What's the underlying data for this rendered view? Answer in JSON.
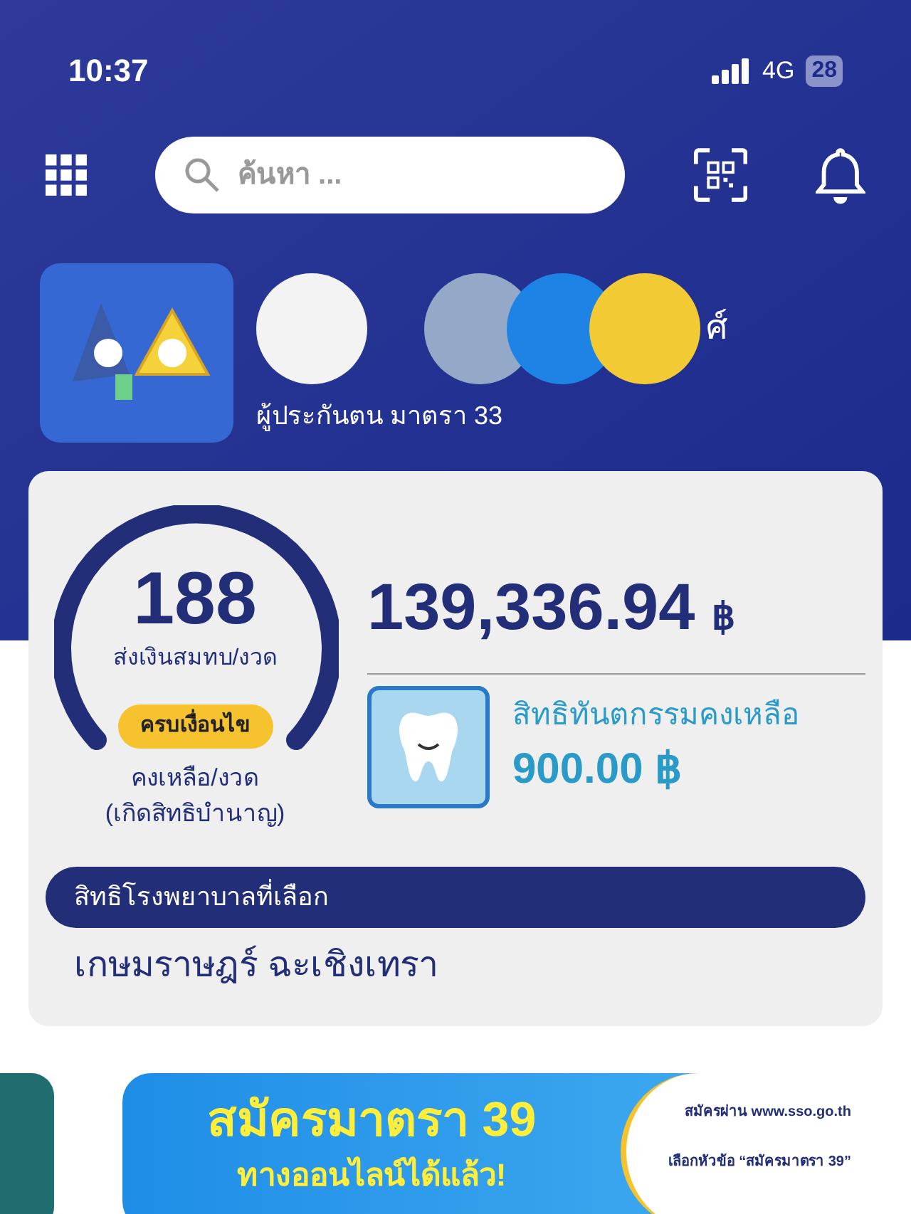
{
  "status_bar": {
    "time": "10:37",
    "network": "4G",
    "battery": "28"
  },
  "search": {
    "placeholder": "ค้นหา ..."
  },
  "profile": {
    "name_fragment": "ศ์",
    "member_type": "ผู้ประกันตน มาตรา 33"
  },
  "summary": {
    "count": "188",
    "count_label": "ส่งเงินสมทบ/งวด",
    "badge": "ครบเงื่อนไข",
    "remaining_label": "คงเหลือ/งวด",
    "remaining_note": "(เกิดสิทธิบำนาญ)",
    "amount": "139,336.94",
    "amount_currency": "฿",
    "dental_label": "สิทธิทันตกรรมคงเหลือ",
    "dental_amount": "900.00 ฿",
    "hospital_label": "สิทธิโรงพยาบาลที่เลือก",
    "hospital_name": "เกษมราษฎร์ ฉะเชิงเทรา"
  },
  "banner": {
    "title": "สมัครมาตรา 39",
    "subtitle": "ทางออนไลน์ได้แล้ว!",
    "line_1": "สมัครผ่าน www.sso.go.th",
    "line_2": "เลือกหัวข้อ “สมัครมาตรา 39”"
  }
}
